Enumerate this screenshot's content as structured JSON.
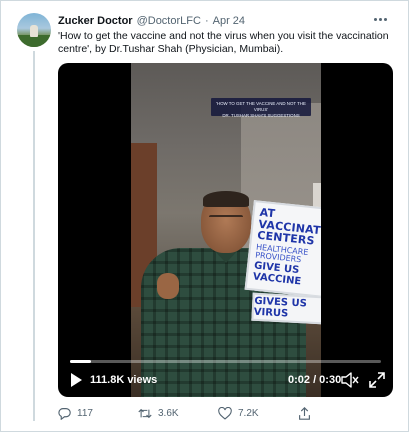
{
  "author": {
    "name": "Zucker Doctor",
    "handle": "@DoctorLFC",
    "separator": "·",
    "date": "Apr 24"
  },
  "tweet": {
    "text": "'How to get the vaccine and not the virus when you visit the vaccination centre', by Dr.Tushar Shah (Physician, Mumbai)."
  },
  "video": {
    "caption_line1": "'HOW TO GET THE VACCINE AND NOT THE VIRUS'",
    "caption_line2": "DR. TUSHAR SHAH'S SUGGESTIONS",
    "sign_line1": "AT VACCINATION CENTERS",
    "sign_line2": "HEALTHCARE PROVIDERS",
    "sign_line3": "GIVE US VACCINE",
    "sign_line4": "GIVES US VIRUS",
    "views": "111.8K views",
    "time": "0:02 / 0:30",
    "progress_fraction": 0.067
  },
  "actions": {
    "replies": "117",
    "retweets": "3.6K",
    "likes": "7.2K"
  },
  "icons": [
    "more-icon",
    "play-icon",
    "volume-icon",
    "fullscreen-icon",
    "reply-icon",
    "retweet-icon",
    "like-icon",
    "share-icon"
  ]
}
